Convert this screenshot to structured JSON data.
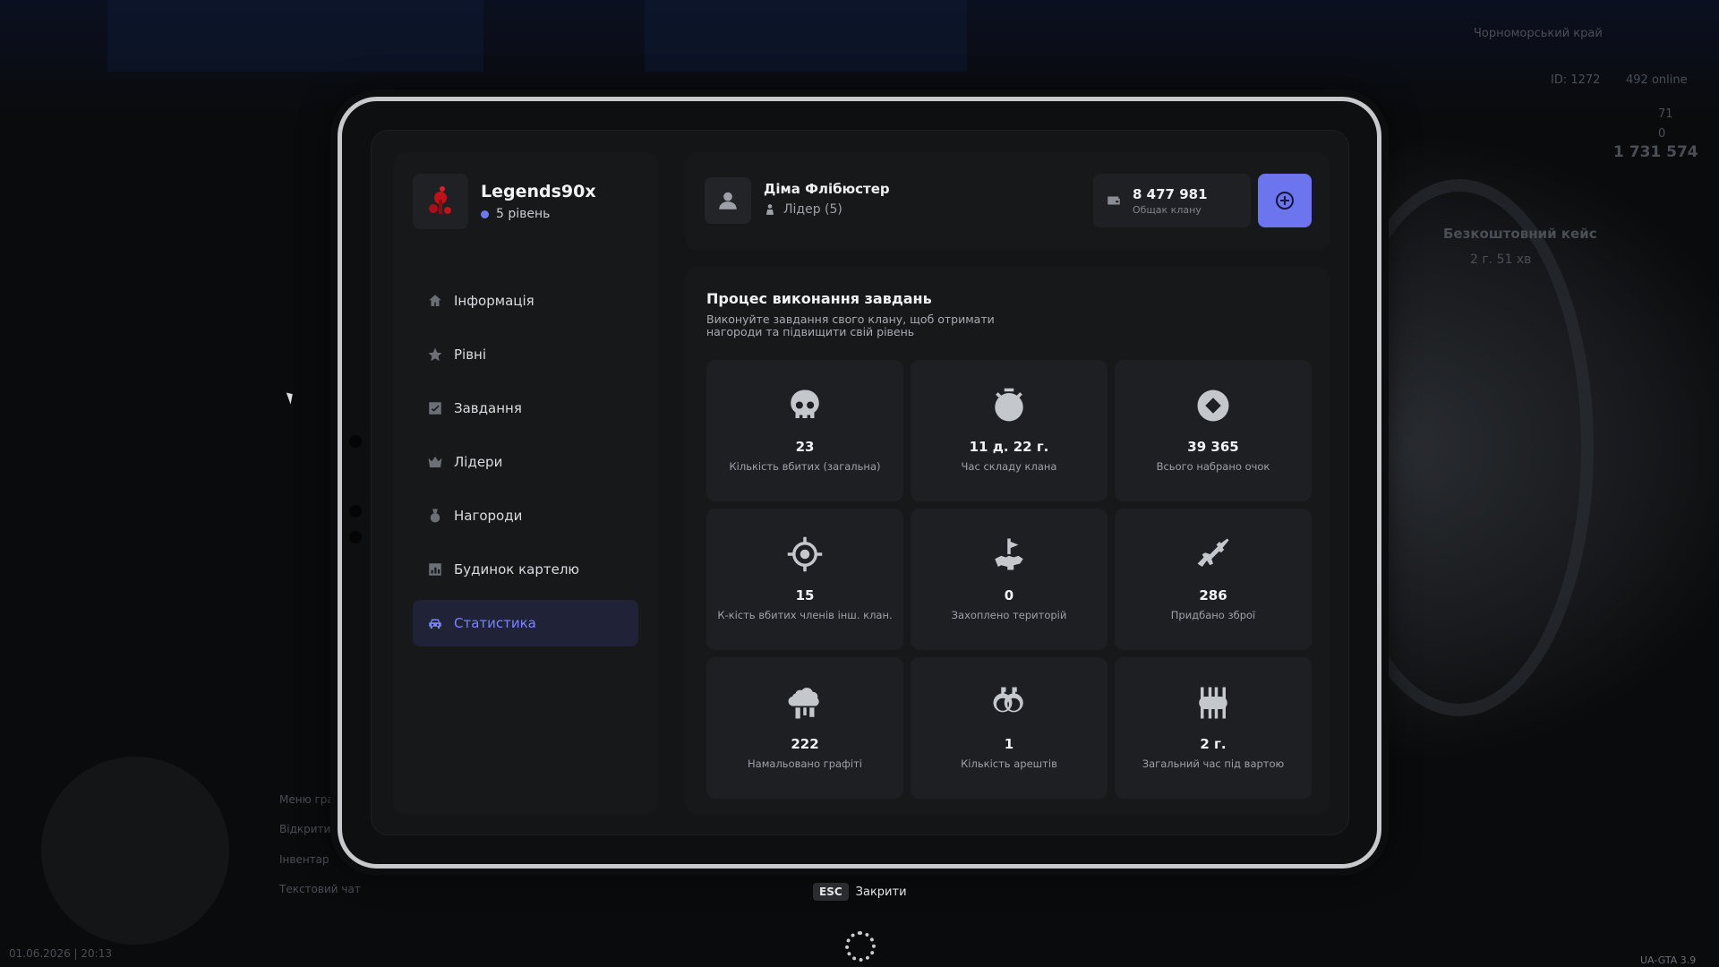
{
  "hud": {
    "region": "Чорноморський край",
    "server_id": "ID: 1272",
    "online": "492 online",
    "health": "71",
    "armor": "0",
    "money": "1 731 574",
    "case_title": "Безкоштовний кейс",
    "case_timer": "2 г. 51 хв",
    "datetime": "01.06.2026 | 20:13",
    "version": "UA-GTA 3.9",
    "hints": [
      "Меню гра",
      "Відкрити",
      "Інвентар",
      "Текстовий чат"
    ]
  },
  "profile": {
    "name": "Legends90x",
    "level": "5 рівень"
  },
  "menu": [
    {
      "label": "Інформація",
      "icon": "home-icon",
      "active": false
    },
    {
      "label": "Рівні",
      "icon": "star-icon",
      "active": false
    },
    {
      "label": "Завдання",
      "icon": "checkbox-icon",
      "active": false
    },
    {
      "label": "Лідери",
      "icon": "crown-icon",
      "active": false
    },
    {
      "label": "Нагороди",
      "icon": "medal-icon",
      "active": false
    },
    {
      "label": "Будинок картелю",
      "icon": "building-icon",
      "active": false
    },
    {
      "label": "Статистика",
      "icon": "car-icon",
      "active": true
    }
  ],
  "header": {
    "user_name": "Діма Флібюстер",
    "user_role": "Лідер (5)",
    "bank_amount": "8 477 981",
    "bank_label": "Общак клану"
  },
  "main": {
    "title": "Процес виконання завдань",
    "subtitle": "Виконуйте завдання свого клану, щоб отримати нагороди та підвищити свій рівень",
    "stats": [
      {
        "value": "23",
        "label": "Кількість вбитих (загальна)",
        "icon": "skull-icon"
      },
      {
        "value": "11 д. 22 г.",
        "label": "Час складу клана",
        "icon": "stopwatch-icon"
      },
      {
        "value": "39 365",
        "label": "Всього набрано очок",
        "icon": "diamond-icon"
      },
      {
        "value": "15",
        "label": "К-кість вбитих членів інш. клан.",
        "icon": "crosshair-icon"
      },
      {
        "value": "0",
        "label": "Захоплено територій",
        "icon": "territory-flag-icon"
      },
      {
        "value": "286",
        "label": "Придбано зброї",
        "icon": "rifle-icon"
      },
      {
        "value": "222",
        "label": "Намальовано графіті",
        "icon": "spray-icon"
      },
      {
        "value": "1",
        "label": "Кількість арештів",
        "icon": "handcuffs-icon"
      },
      {
        "value": "2 г.",
        "label": "Загальний час під вартою",
        "icon": "prison-bars-icon"
      }
    ]
  },
  "footer": {
    "esc_key": "ESC",
    "close_label": "Закрити"
  }
}
